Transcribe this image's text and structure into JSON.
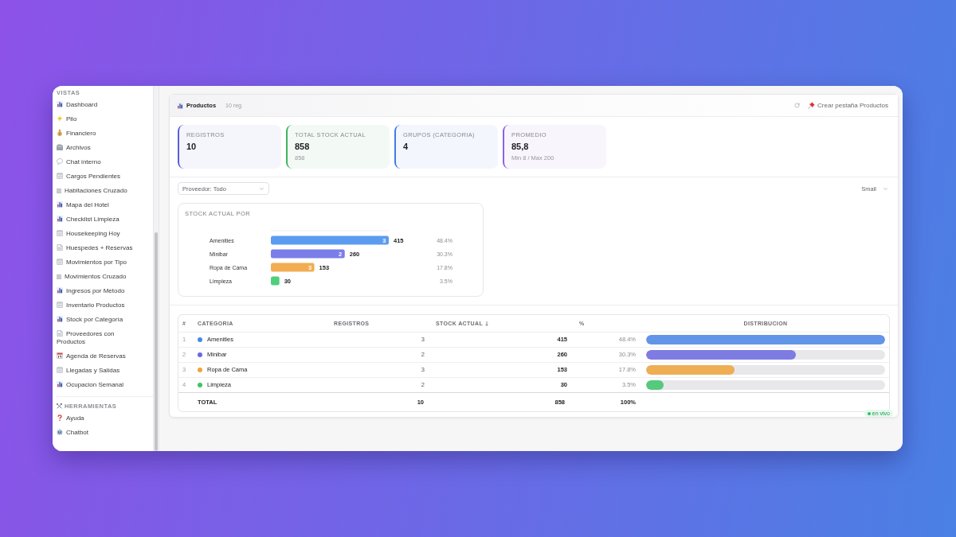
{
  "sidebar": {
    "sections": [
      {
        "title": "VISTAS",
        "kind": "plain",
        "items": [
          {
            "label": "Dashboard",
            "kind": "chart",
            "selected": false
          },
          {
            "label": "Pilo",
            "kind": "bolt",
            "selected": false
          },
          {
            "label": "Financiero",
            "kind": "money-bag",
            "selected": false
          },
          {
            "label": "Archivos",
            "kind": "card-index",
            "selected": false
          },
          {
            "label": "Chat interno",
            "kind": "speech",
            "selected": false
          },
          {
            "label": "Cargos Pendientes",
            "kind": "sheet",
            "selected": false
          },
          {
            "label": "Habitaciones Cruzado",
            "kind": "lines",
            "selected": false
          },
          {
            "label": "Mapa del Hotel",
            "kind": "chart",
            "selected": false
          },
          {
            "label": "Checklist Limpieza",
            "kind": "chart",
            "selected": false
          },
          {
            "label": "Housekeeping Hoy",
            "kind": "sheet",
            "selected": false
          },
          {
            "label": "Huespedes + Reservas",
            "kind": "page",
            "selected": false
          },
          {
            "label": "Movimientos por Tipo",
            "kind": "sheet",
            "selected": false
          },
          {
            "label": "Movimientos Cruzado",
            "kind": "lines",
            "selected": false
          },
          {
            "label": "Ingresos por Metodo",
            "kind": "chart",
            "selected": false
          },
          {
            "label": "Inventario Productos",
            "kind": "sheet",
            "selected": false
          },
          {
            "label": "Stock por Categoría",
            "kind": "chart",
            "selected": false
          },
          {
            "label": "Proveedores con Productos",
            "kind": "page",
            "selected": false
          },
          {
            "label": "Agenda de Reservas",
            "kind": "calendar",
            "selected": false
          },
          {
            "label": "Llegadas y Salidas",
            "kind": "sheet",
            "selected": false
          },
          {
            "label": "Ocupacion Semanal",
            "kind": "chart",
            "selected": false
          }
        ]
      },
      {
        "title": "HERRAMIENTAS",
        "kind": "tools",
        "items": [
          {
            "label": "Ayuda",
            "kind": "question",
            "selected": false
          },
          {
            "label": "Chatbot",
            "kind": "robot",
            "selected": false
          }
        ]
      }
    ]
  },
  "panel": {
    "title": "Productos",
    "count": "10 reg.",
    "create_tab_button": "Crear pestaña Productos",
    "stats": [
      {
        "label": "REGISTROS",
        "value": "10",
        "color": "#5b5fd6"
      },
      {
        "label": "TOTAL STOCK ACTUAL",
        "value": "858",
        "note": "858",
        "color": "#3fb35f"
      },
      {
        "label": "GRUPOS (CATEGORIA)",
        "value": "4",
        "color": "#3b7fe0"
      },
      {
        "label": "PROMEDIO",
        "value": "85,8",
        "note": "Min 8 / Max 200",
        "color": "#8b62e0"
      }
    ],
    "supplier_filter": {
      "value": "Proveedor: Todo"
    },
    "size_select": {
      "value": "Small"
    },
    "chart": {
      "title": "STOCK ACTUAL POR",
      "chart_data": {
        "type": "bar",
        "orientation": "horizontal",
        "categories": [
          "Amenities",
          "Minibar",
          "Ropa de Cama",
          "Limpieza"
        ],
        "values": [
          415,
          260,
          153,
          30
        ],
        "data_labels": true
      },
      "bars": [
        {
          "color": "#5b9cf0",
          "count": "3",
          "share": "48.4%"
        },
        {
          "color": "#7b7de8",
          "count": "2",
          "share": "30.3%"
        },
        {
          "color": "#f2ad52",
          "count": "3",
          "share": "17.8%"
        },
        {
          "color": "#4fcf7c",
          "share": "3.5%"
        }
      ]
    },
    "table": {
      "columns": [
        {
          "label": "#",
          "sorted": false
        },
        {
          "label": "CATEGORIA",
          "sorted": false
        },
        {
          "label": "REGISTROS",
          "sorted": false
        },
        {
          "label": "STOCK ACTUAL",
          "sorted": true
        },
        {
          "label": "%",
          "sorted": false
        },
        {
          "label": "DISTRIBUCION",
          "sorted": false
        }
      ],
      "rows": [
        {
          "number": "1",
          "category": "Amenities",
          "color": "#4a86e8",
          "records": "3",
          "stock": "415",
          "share": "48.4%",
          "level": 1
        },
        {
          "number": "2",
          "category": "Minibar",
          "color": "#6b68e0",
          "records": "2",
          "stock": "260",
          "share": "30.3%",
          "level": 0.627
        },
        {
          "number": "3",
          "category": "Ropa de Cama",
          "color": "#eea33a",
          "records": "3",
          "stock": "153",
          "share": "17.8%",
          "level": 0.369
        },
        {
          "number": "4",
          "category": "Limpieza",
          "color": "#3cc36a",
          "records": "2",
          "stock": "30",
          "share": "3.5%",
          "level": 0.072
        }
      ],
      "total": {
        "label": "TOTAL",
        "records": "10",
        "stock": "858",
        "share": "100%"
      }
    },
    "live_badge": "en vivo"
  }
}
